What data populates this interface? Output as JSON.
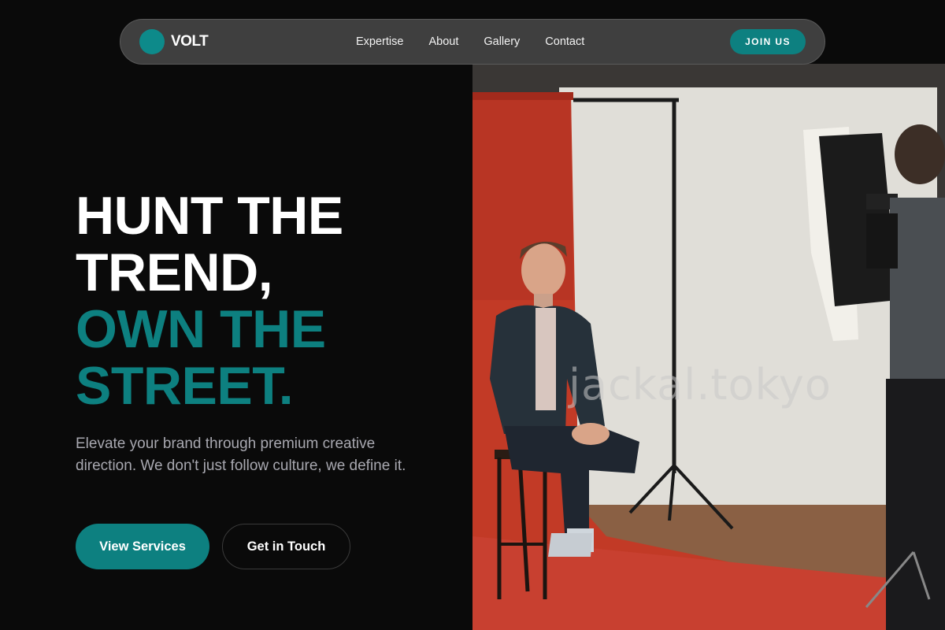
{
  "brand": {
    "name": "VOLT",
    "accent_color": "#0d8080"
  },
  "nav": {
    "links": [
      "Expertise",
      "About",
      "Gallery",
      "Contact"
    ],
    "cta_label": "JOIN US"
  },
  "hero": {
    "headline_line1": "HUNT THE",
    "headline_line2": "TREND,",
    "headline_line3": "OWN THE",
    "headline_line4": "STREET.",
    "subtitle": "Elevate your brand through premium creative direction. We don't just follow culture, we define it.",
    "primary_button": "View Services",
    "secondary_button": "Get in Touch"
  },
  "photo": {
    "watermark": "jackal.tokyo"
  }
}
